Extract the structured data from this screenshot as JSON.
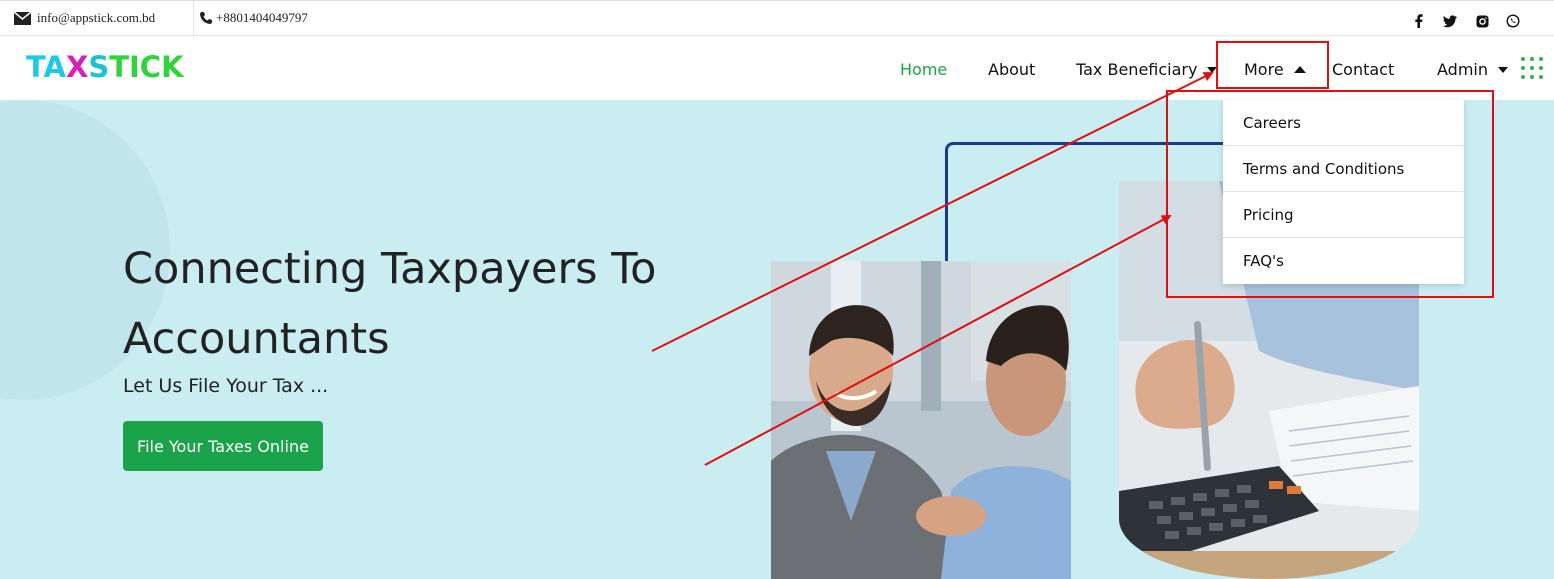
{
  "topbar": {
    "email": "info@appstick.com.bd",
    "phone": "+8801404049797",
    "social": [
      "facebook-icon",
      "twitter-icon",
      "instagram-icon",
      "whatsapp-icon"
    ]
  },
  "brand": {
    "logo_text": "TAXSTICK",
    "colors": {
      "cyan": "#1ec8e8",
      "green": "#2fd33a",
      "magenta": "#d81fb8",
      "accent": "#1aa34a"
    }
  },
  "nav": {
    "home": "Home",
    "about": "About",
    "tax_beneficiary": "Tax Beneficiary",
    "more": "More",
    "contact": "Contact",
    "admin": "Admin"
  },
  "dropdown": {
    "items": [
      "Careers",
      "Terms and Conditions",
      "Pricing",
      "FAQ's"
    ]
  },
  "hero": {
    "title_line1": "Connecting Taxpayers To",
    "title_line2": "Accountants",
    "subtitle": "Let Us File Your Tax ...",
    "cta": "File Your Taxes Online",
    "bg": "#caedf2"
  },
  "annotation_color": "#e01010"
}
